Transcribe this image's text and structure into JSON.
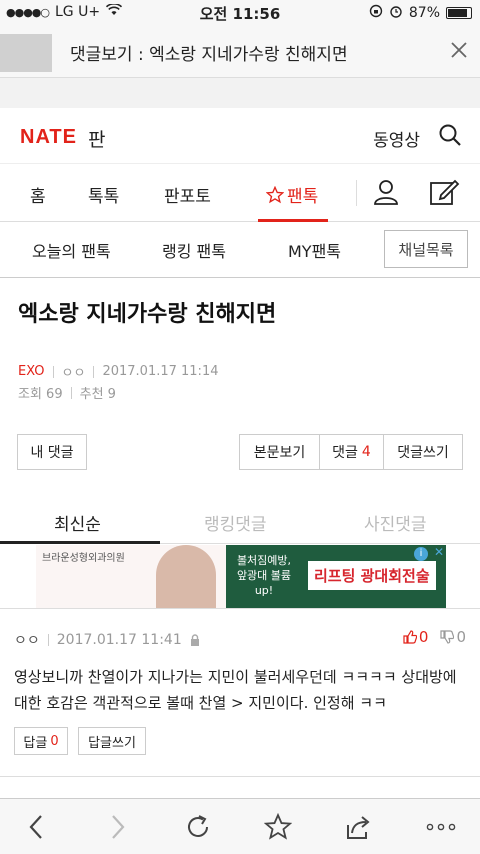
{
  "status": {
    "carrier": "LG U+",
    "time": "오전 11:56",
    "battery": "87%"
  },
  "urlbar": {
    "title": "댓글보기 : 엑소랑 지네가수랑 친해지면"
  },
  "header": {
    "logo": "NATE",
    "logo_sub": "판",
    "video": "동영상"
  },
  "gnb": {
    "items": [
      "홈",
      "톡톡",
      "판포토",
      "팬톡"
    ]
  },
  "subnav": {
    "items": [
      "오늘의 팬톡",
      "랭킹 팬톡",
      "MY팬톡"
    ],
    "channel_button": "채널목록"
  },
  "article": {
    "title": "엑소랑 지네가수랑 친해지면",
    "category": "EXO",
    "author": "ㅇㅇ",
    "date": "2017.01.17 11:14",
    "views": "조회 69",
    "recommends": "추천 9"
  },
  "actions": {
    "my_comments": "내 댓글",
    "view_post": "본문보기",
    "comments_label": "댓글",
    "comments_count": "4",
    "write_comment": "댓글쓰기"
  },
  "sort_tabs": [
    "최신순",
    "랭킹댓글",
    "사진댓글"
  ],
  "ad": {
    "brand": "브라운성형외과의원",
    "copy": "볼처짐예방, 앞광대 볼륨 up!",
    "banner": "리프팅 광대회전술"
  },
  "comments": [
    {
      "author": "ㅇㅇ",
      "date": "2017.01.17 11:41",
      "up": "0",
      "down": "0",
      "text": "영상보니까 찬열이가 지나가는 지민이 불러세우던데 ㅋㅋㅋㅋ 상대방에 대한 호감은 객관적으로 볼때 찬열 > 지민이다. 인정해 ㅋㅋ",
      "reply_label": "답글",
      "reply_count": "0",
      "write_reply": "답글쓰기"
    }
  ],
  "colors": {
    "accent": "#e2231a",
    "muted": "#999999"
  }
}
